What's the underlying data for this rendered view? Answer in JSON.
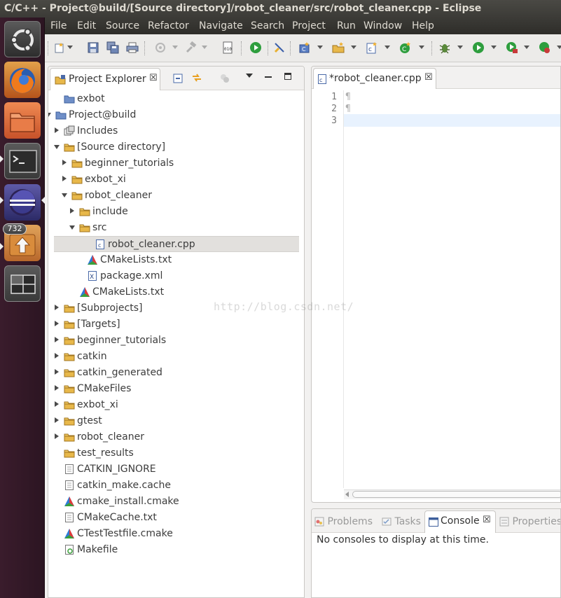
{
  "window": {
    "title": "C/C++ - Project@build/[Source directory]/robot_cleaner/src/robot_cleaner.cpp - Eclipse"
  },
  "launcher": {
    "items": [
      {
        "name": "ubuntu-dash",
        "icon": "ubuntu-logo-icon"
      },
      {
        "name": "firefox",
        "icon": "firefox-icon"
      },
      {
        "name": "files",
        "icon": "folder-icon"
      },
      {
        "name": "terminal",
        "icon": "terminal-icon"
      },
      {
        "name": "eclipse",
        "icon": "eclipse-icon"
      },
      {
        "name": "software-updater",
        "icon": "update-icon",
        "badge": "732"
      },
      {
        "name": "workspace-switcher",
        "icon": "workspaces-icon"
      }
    ]
  },
  "menubar": {
    "items": [
      "File",
      "Edit",
      "Source",
      "Refactor",
      "Navigate",
      "Search",
      "Project",
      "Run",
      "Window",
      "Help"
    ]
  },
  "explorer": {
    "tab_label": "Project Explorer",
    "tree": [
      {
        "label": "exbot",
        "kind": "project"
      },
      {
        "label": "Project@build",
        "kind": "project"
      },
      {
        "label": "Includes",
        "kind": "includes"
      },
      {
        "label": "[Source directory]",
        "kind": "folder"
      },
      {
        "label": "beginner_tutorials",
        "kind": "folder"
      },
      {
        "label": "exbot_xi",
        "kind": "folder"
      },
      {
        "label": "robot_cleaner",
        "kind": "folder"
      },
      {
        "label": "include",
        "kind": "folder"
      },
      {
        "label": "src",
        "kind": "folder"
      },
      {
        "label": "robot_cleaner.cpp",
        "kind": "cpp"
      },
      {
        "label": "CMakeLists.txt",
        "kind": "cmake"
      },
      {
        "label": "package.xml",
        "kind": "xml"
      },
      {
        "label": "CMakeLists.txt",
        "kind": "cmake"
      },
      {
        "label": "[Subprojects]",
        "kind": "folder"
      },
      {
        "label": "[Targets]",
        "kind": "folder"
      },
      {
        "label": "beginner_tutorials",
        "kind": "folder"
      },
      {
        "label": "catkin",
        "kind": "folder"
      },
      {
        "label": "catkin_generated",
        "kind": "folder"
      },
      {
        "label": "CMakeFiles",
        "kind": "folder"
      },
      {
        "label": "exbot_xi",
        "kind": "folder"
      },
      {
        "label": "gtest",
        "kind": "folder"
      },
      {
        "label": "robot_cleaner",
        "kind": "folder"
      },
      {
        "label": "test_results",
        "kind": "folder"
      },
      {
        "label": "CATKIN_IGNORE",
        "kind": "file"
      },
      {
        "label": "catkin_make.cache",
        "kind": "file"
      },
      {
        "label": "cmake_install.cmake",
        "kind": "cmake"
      },
      {
        "label": "CMakeCache.txt",
        "kind": "file"
      },
      {
        "label": "CTestTestfile.cmake",
        "kind": "cmake"
      },
      {
        "label": "Makefile",
        "kind": "makefile"
      }
    ],
    "selected": "robot_cleaner.cpp"
  },
  "editor": {
    "tab_label": "*robot_cleaner.cpp",
    "line_numbers": [
      "1",
      "2",
      "3"
    ],
    "lines": [
      "¶",
      "¶",
      ""
    ]
  },
  "bottom_panel": {
    "tabs": [
      "Problems",
      "Tasks",
      "Console",
      "Properties"
    ],
    "active_tab": "Console",
    "message": "No consoles to display at this time."
  },
  "watermark": "http://blog.csdn.net/",
  "colors": {
    "title_bar": "#3c3b37",
    "launcher": "#2c1522",
    "folder": "#e8b84a",
    "selection": "#e2e0dd",
    "current_line": "#e8f2fe"
  }
}
